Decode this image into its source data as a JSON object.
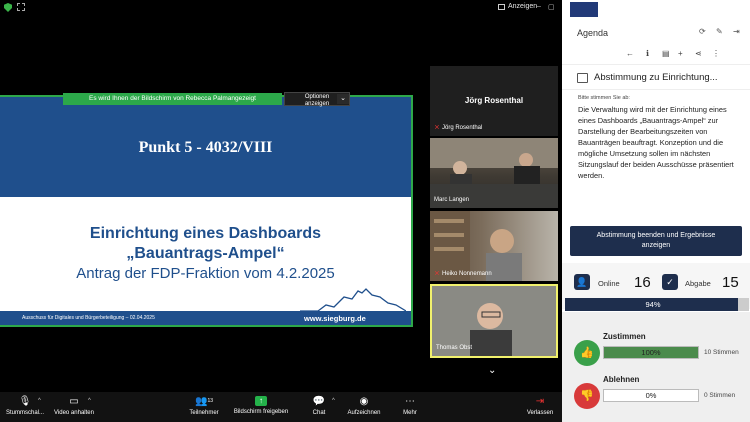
{
  "zoom": {
    "view_label": "Anzeigen",
    "share_banner": "Es wird Ihnen der Bildschirm von  Rebecca Palmangezeigt",
    "options_label_line1": "Optionen",
    "options_label_line2": "anzeigen"
  },
  "slide": {
    "title": "Punkt 5 - 4032/VIII",
    "heading_line1": "Einrichtung eines Dashboards",
    "heading_line2": "„Bauantrags-Ampel“",
    "subtitle": "Antrag der FDP-Fraktion vom 4.2.2025",
    "footer": "Ausschuss für Digitales und Bürgerbeteiligung – 02.04.2025",
    "url": "www.siegburg.de"
  },
  "participants": [
    {
      "name": "Jörg Rosenthal",
      "muted": true
    },
    {
      "name": "Marc Langen",
      "muted": false
    },
    {
      "name": "Heiko Nonnemann",
      "muted": true
    },
    {
      "name": "Thomas Obst",
      "muted": false
    }
  ],
  "toolbar": {
    "mute": "Stummschal...",
    "video": "Video anhalten",
    "participants": "Teilnehmer",
    "participants_count": "13",
    "share": "Bildschirm freigeben",
    "chat": "Chat",
    "record": "Aufzeichnen",
    "more": "Mehr",
    "leave": "Verlassen"
  },
  "panel": {
    "title": "Agenda",
    "vote_title": "Abstimmung zu Einrichtung...",
    "prompt": "Bitte stimmen Sie ab:",
    "description": "Die Verwaltung wird mit der Einrichtung eines eines Dashboards „Bauantrags-Ampel“ zur Darstellung der Bearbeitungszeiten von Bauanträgen beauftragt. Konzeption und die mögliche Umsetzung sollen im nächsten Sitzungslauf der beiden Ausschüsse präsentiert werden.",
    "end_button_line1": "Abstimmung beenden und Ergebnisse",
    "end_button_line2": "anzeigen",
    "online_label": "Online",
    "online_value": "16",
    "submitted_label": "Abgabe",
    "submitted_value": "15",
    "progress_label": "94%",
    "progress_fraction": 0.94,
    "options": [
      {
        "name": "Zustimmen",
        "percent_label": "100%",
        "fraction": 1.0,
        "count": "10 Stimmen"
      },
      {
        "name": "Ablehnen",
        "percent_label": "0%",
        "fraction": 0.0,
        "count": "0 Stimmen"
      }
    ]
  },
  "colors": {
    "navy": "#1e2e4d",
    "slide_blue": "#1f4f8c",
    "share_green": "#2ca84a",
    "approve_green": "#3aa04a",
    "reject_red": "#d83a3a"
  }
}
